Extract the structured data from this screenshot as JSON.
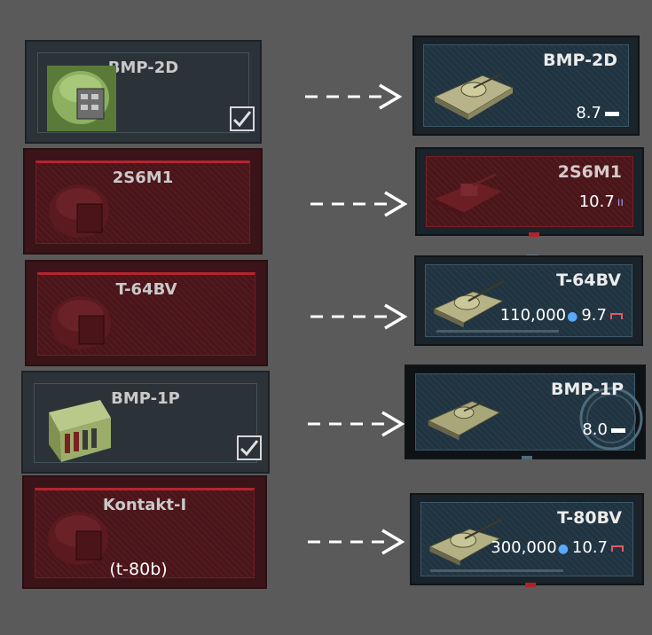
{
  "modifications": [
    {
      "title": "BMP-2D",
      "sub": "",
      "icon": "green-armor-module-icon",
      "locked": false,
      "checked": true
    },
    {
      "title": "2S6M1",
      "sub": "",
      "icon": "locked-turret-icon",
      "locked": true,
      "checked": false
    },
    {
      "title": "T-64BV",
      "sub": "",
      "icon": "locked-turret-icon",
      "locked": true,
      "checked": false
    },
    {
      "title": "BMP-1P",
      "sub": "",
      "icon": "ammo-crate-icon",
      "locked": false,
      "checked": true
    },
    {
      "title": "Kontakt-I",
      "sub": "(t-80b)",
      "icon": "locked-turret-icon",
      "locked": true,
      "checked": false
    }
  ],
  "vehicles": [
    {
      "name": "BMP-2D",
      "rp": "",
      "br": "8.7",
      "rank_type": "light-tank",
      "locked": false
    },
    {
      "name": "2S6M1",
      "rp": "",
      "br": "10.7",
      "rank_type": "spaa",
      "locked": true
    },
    {
      "name": "T-64BV",
      "rp": "110,000",
      "br": "9.7",
      "rank_type": "medium-tank",
      "locked": false
    },
    {
      "name": "BMP-1P",
      "rp": "",
      "br": "8.0",
      "rank_type": "light-tank",
      "locked": false
    },
    {
      "name": "T-80BV",
      "rp": "300,000",
      "br": "10.7",
      "rank_type": "medium-tank",
      "locked": false
    }
  ],
  "colors": {
    "background": "#5a5a5a",
    "locked_red": "#4a1419",
    "accent_red": "#b3262d",
    "card_dark": "#2b3238",
    "vehicle_blue": "#1f3340"
  }
}
